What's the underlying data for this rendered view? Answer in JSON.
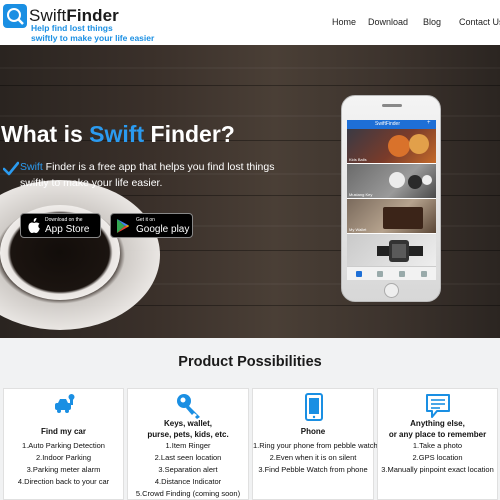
{
  "header": {
    "logo": {
      "light": "Swift",
      "bold": "Finder"
    },
    "tagline_line1": "Help find lost things",
    "tagline_line2": "swiftly to make your life easier",
    "nav": [
      "Home",
      "Download",
      "Blog",
      "Contact Us"
    ]
  },
  "hero": {
    "title_prefix": "What is ",
    "title_highlight": "Swift",
    "title_suffix": " Finder?",
    "desc_highlight": "Swift",
    "desc_line1_rest": " Finder is a free app that helps you find lost things",
    "desc_line2": "swiftly to make your life easier.",
    "apple_small": "Download on the",
    "apple_big": "App Store",
    "google_small": "Get it on",
    "google_big": "Google play"
  },
  "phone": {
    "app_title": "SwiftFinder",
    "add_symbol": "+",
    "items": [
      {
        "caption": "Kids Balls"
      },
      {
        "caption": "Mustang Key"
      },
      {
        "caption": "My Wallet"
      },
      {
        "caption": ""
      }
    ]
  },
  "section": {
    "title": "Product Possibilities"
  },
  "cards": [
    {
      "title": "Find my car",
      "lines": [
        "1.Auto Parking Detection",
        "2.Indoor Parking",
        "3.Parking meter alarm",
        "4.Direction back to your car"
      ]
    },
    {
      "title_lines": [
        "Keys, wallet,",
        "purse, pets, kids, etc."
      ],
      "lines": [
        "1.Item Ringer",
        "2.Last seen location",
        "3.Separation alert",
        "4.Distance Indicator",
        "5.Crowd Finding (coming soon)"
      ]
    },
    {
      "title": "Phone",
      "lines": [
        "1.Ring your phone from pebble watch",
        "2.Even when it is on silent",
        "3.Find Pebble Watch from phone"
      ]
    },
    {
      "title_lines": [
        "Anything else,",
        "or any place to remember"
      ],
      "lines": [
        "1.Take a photo",
        "2.GPS location",
        "3.Manually pinpoint exact location"
      ]
    }
  ],
  "colors": {
    "accent": "#2b9bf0",
    "tagline": "#1a8fe3",
    "app_bar": "#1e6fd6"
  },
  "icons": [
    "swiftfinder-logo-icon",
    "checkmark-icon",
    "apple-icon",
    "google-play-icon",
    "car-key-icon",
    "key-icon",
    "phone-icon",
    "chat-note-icon"
  ]
}
